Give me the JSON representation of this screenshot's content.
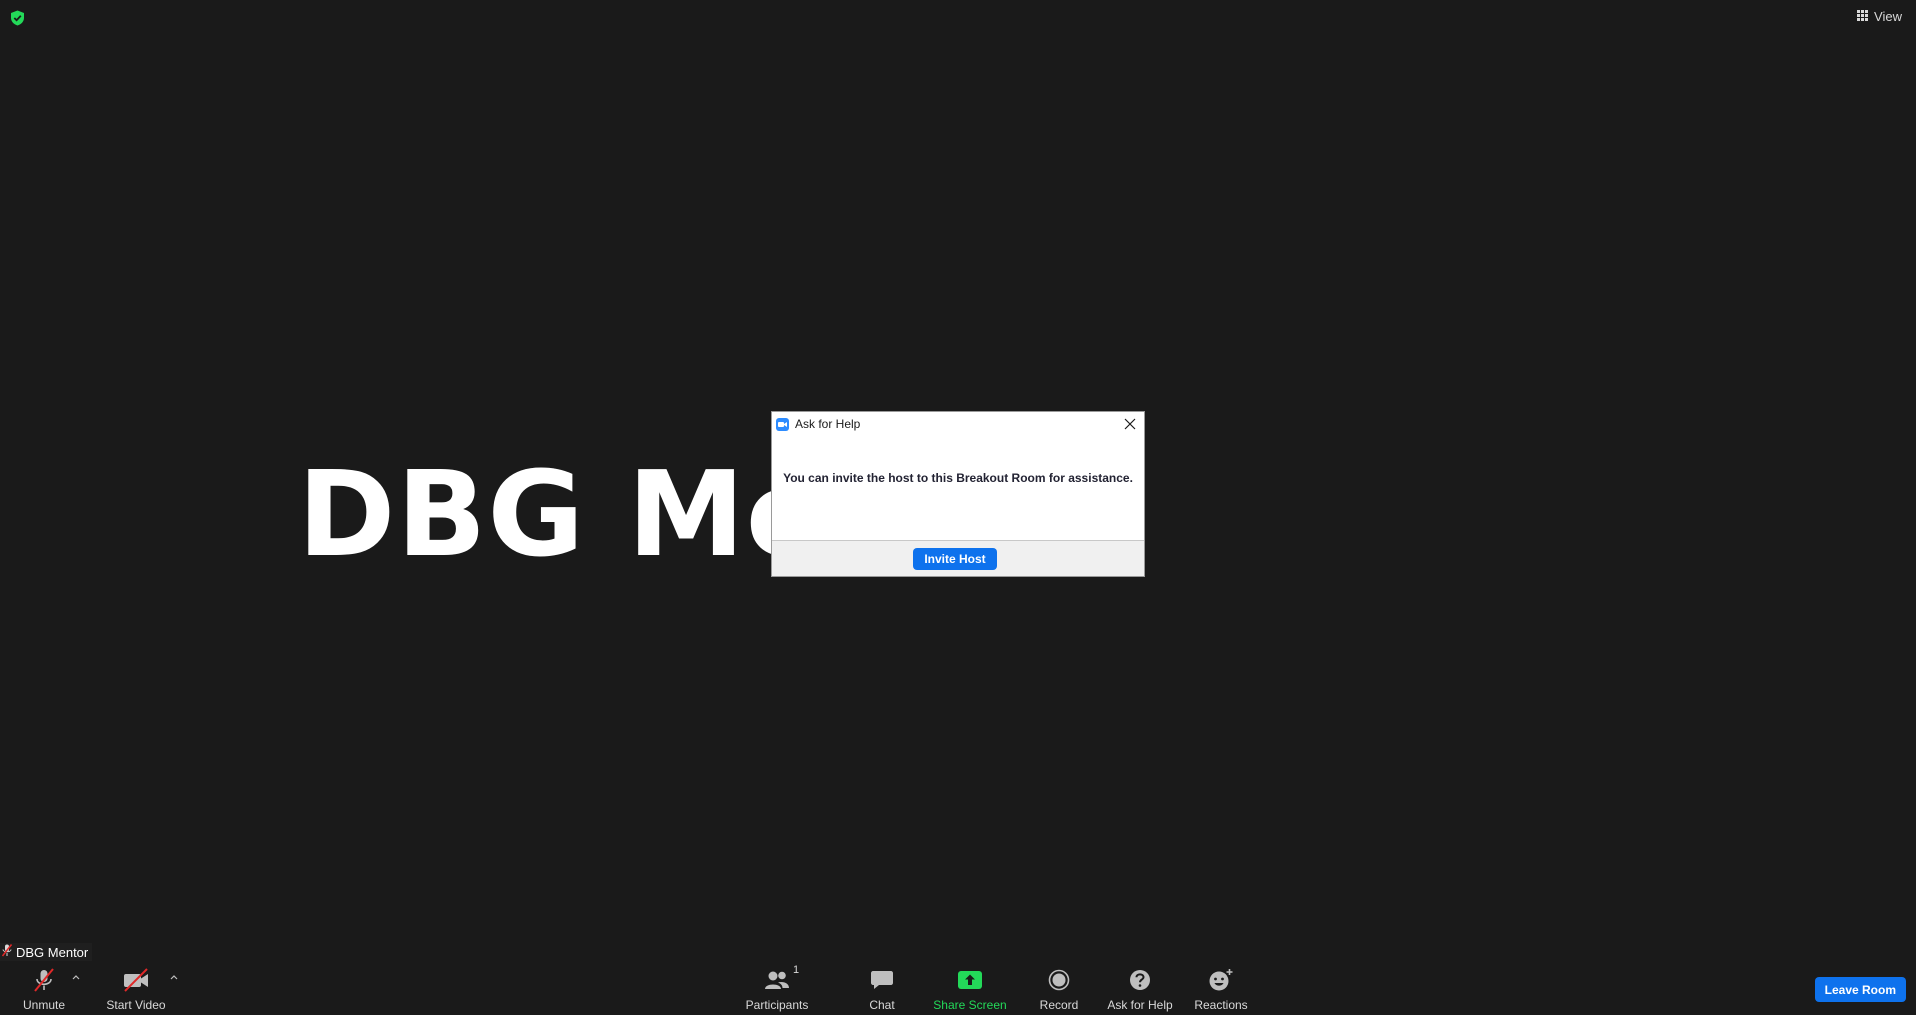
{
  "meeting": {
    "participant_display_name": "DBG Mentor",
    "view_label": "View"
  },
  "dialog": {
    "title": "Ask for Help",
    "message": "You can invite the host to this Breakout Room for assistance.",
    "primary_button": "Invite Host"
  },
  "name_tag": {
    "name": "DBG Mentor"
  },
  "toolbar": {
    "unmute_label": "Unmute",
    "start_video_label": "Start Video",
    "participants_label": "Participants",
    "participants_count": "1",
    "chat_label": "Chat",
    "share_screen_label": "Share Screen",
    "record_label": "Record",
    "ask_for_help_label": "Ask for Help",
    "reactions_label": "Reactions",
    "leave_label": "Leave Room"
  },
  "colors": {
    "background": "#1a1a1a",
    "accent_blue": "#0e72ed",
    "share_green": "#23d959",
    "muted_red": "#e02828",
    "security_green": "#23d959"
  },
  "icons": {
    "security": "shield-check-icon",
    "view": "grid-icon",
    "unmute": "microphone-muted-icon",
    "video": "video-off-icon",
    "participants": "people-icon",
    "chat": "chat-bubble-icon",
    "share": "share-screen-icon",
    "record": "record-icon",
    "help": "question-icon",
    "reactions": "emoji-icon"
  }
}
